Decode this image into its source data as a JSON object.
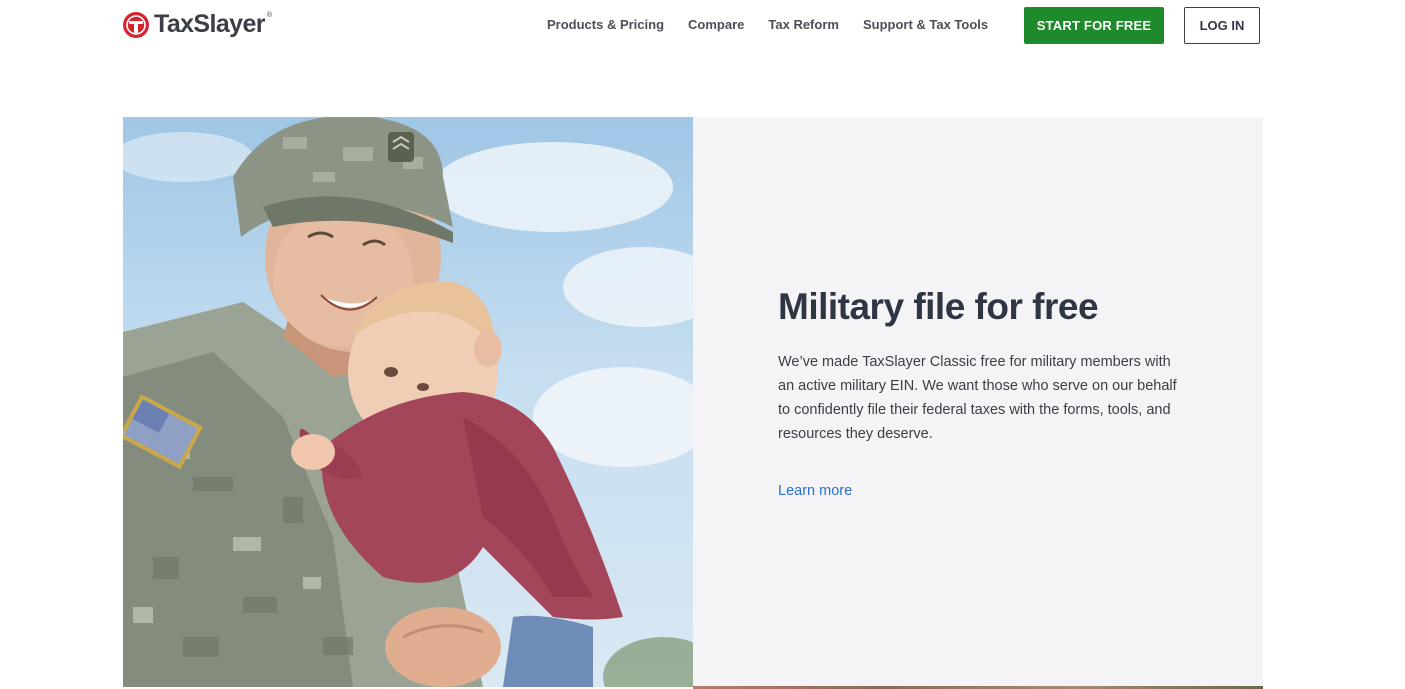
{
  "header": {
    "brand": "TaxSlayer",
    "brand_mark": "®",
    "nav": [
      {
        "label": "Products & Pricing"
      },
      {
        "label": "Compare"
      },
      {
        "label": "Tax Reform"
      },
      {
        "label": "Support & Tax Tools"
      }
    ],
    "start_label": "START FOR FREE",
    "login_label": "LOG IN"
  },
  "hero": {
    "title": "Military file for free",
    "body": "We’ve made TaxSlayer Classic free for military members with an active military EIN. We want those who serve on our behalf to confidently file their federal taxes with the forms, tools, and resources they deserve.",
    "link_label": "Learn more",
    "image_icon": "soldier-holding-child-photo"
  },
  "colors": {
    "brand_red": "#d5232f",
    "start_button": "#1e8a2b",
    "link": "#2a6fd6",
    "panel_bg": "#f4f4f6"
  }
}
